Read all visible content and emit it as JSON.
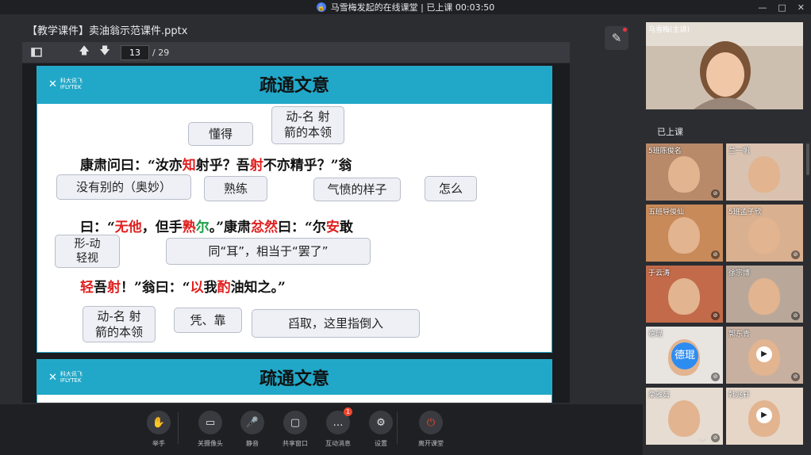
{
  "window": {
    "title": "马雪梅发起的在线课堂 | 已上课 00:03:50",
    "controls": [
      "—",
      "□",
      "✕"
    ]
  },
  "document": {
    "title": "【教学课件】卖油翁示范课件.pptx",
    "current_page": "13",
    "total_pages": "/ 29"
  },
  "slide": {
    "logo_brand": "科大讯飞",
    "logo_sub": "IFLYTEK",
    "title": "疏通文意",
    "bubbles": [
      "懂得",
      "动-名 射\n箭的本领",
      "没有别的（奥妙）",
      "熟练",
      "气愤的样子",
      "怎么",
      "形-动\n轻视",
      "同“耳”，相当于“罢了”",
      "动-名 射\n箭的本领",
      "凭、靠",
      "舀取，这里指倒入"
    ],
    "line1": [
      "康肃问曰：“汝亦",
      "知",
      "射乎？吾",
      "射",
      "不亦精乎？”翁"
    ],
    "line2": [
      "曰：“",
      "无他",
      "，但手",
      "熟",
      "尔",
      "。”康肃",
      "忿然",
      "曰：“尔",
      "安",
      "敢"
    ],
    "line3": [
      "轻",
      "吾",
      "射",
      "！”翁曰：“",
      "以",
      "我",
      "酌",
      "油知之。”"
    ]
  },
  "slide2": {
    "logo_brand": "科大讯飞",
    "logo_sub": "IFLYTEK",
    "title": "疏通文意"
  },
  "sidebar": {
    "teacher_name": "马雪梅(主讲)",
    "status": "已上课",
    "students": [
      {
        "name": "5班陈俊名",
        "muted": true,
        "bg": "#b98a6a"
      },
      {
        "name": "兰一帆",
        "muted": false,
        "bg": "#d9c2b0"
      },
      {
        "name": "五班导俊仙",
        "muted": true,
        "bg": "#c98a5a"
      },
      {
        "name": "5班孟子欣",
        "muted": true,
        "bg": "#d9b090"
      },
      {
        "name": "于云涛",
        "muted": true,
        "bg": "#c26a4a"
      },
      {
        "name": "徐宗博",
        "muted": true,
        "bg": "#b9a89a"
      },
      {
        "name": "德琨",
        "muted": true,
        "bg": "#e8e4e0",
        "avatar": "德琨"
      },
      {
        "name": "郭东青",
        "muted": true,
        "bg": "#c8b0a0",
        "play": true
      },
      {
        "name": "栾雅茹",
        "muted": true,
        "bg": "#e6dcd2"
      },
      {
        "name": "韩兆轩",
        "muted": false,
        "bg": "#e6d6c8",
        "play": true
      }
    ]
  },
  "controls": [
    {
      "label": "举手",
      "icon": "hand-icon"
    },
    {
      "label": "关摄像头",
      "icon": "camera-icon"
    },
    {
      "label": "静音",
      "icon": "microphone-icon"
    },
    {
      "label": "共享窗口",
      "icon": "screen-share-icon"
    },
    {
      "label": "互动消息",
      "icon": "chat-icon",
      "badge": "1"
    },
    {
      "label": "设置",
      "icon": "gear-icon"
    },
    {
      "label": "离开课堂",
      "icon": "power-icon"
    }
  ],
  "colors": {
    "accent": "#21a8c8",
    "highlight_red": "#e02020",
    "highlight_green": "#1aa04a",
    "leave_red": "#f0452c"
  }
}
